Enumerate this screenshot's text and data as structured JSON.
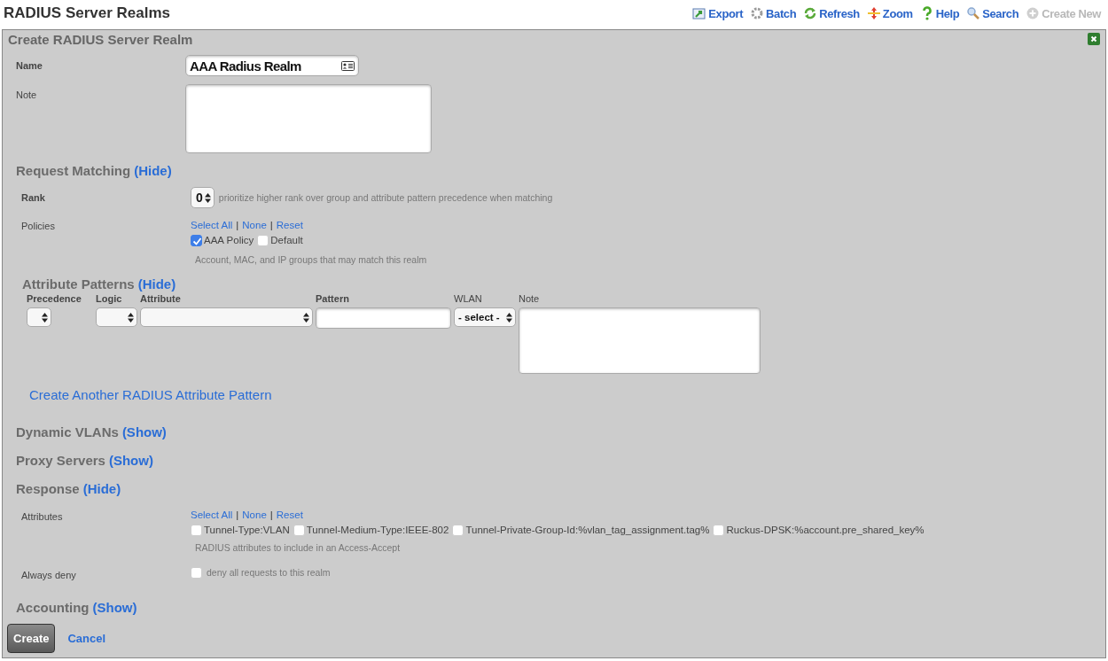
{
  "page_title": "RADIUS Server Realms",
  "toolbar": [
    {
      "kind": "export",
      "label": "Export",
      "disabled": false
    },
    {
      "kind": "batch",
      "label": "Batch",
      "disabled": false
    },
    {
      "kind": "refresh",
      "label": "Refresh",
      "disabled": false
    },
    {
      "kind": "zoom",
      "label": "Zoom",
      "disabled": false
    },
    {
      "kind": "help",
      "label": "Help",
      "disabled": false
    },
    {
      "kind": "search",
      "label": "Search",
      "disabled": false
    },
    {
      "kind": "create",
      "label": "Create New",
      "disabled": true
    }
  ],
  "panel": {
    "title": "Create RADIUS Server Realm"
  },
  "name": {
    "label": "Name",
    "value": "AAA Radius Realm",
    "required": true
  },
  "note": {
    "label": "Note",
    "required": false
  },
  "request_matching": {
    "title": "Request Matching",
    "toggle": "(Hide)",
    "rank": {
      "label": "Rank",
      "required": true,
      "value": "0",
      "hint": "prioritize higher rank over group and attribute pattern precedence when matching"
    },
    "policies": {
      "label": "Policies",
      "required": false,
      "links": {
        "items": [
          "Select All",
          "None",
          "Reset"
        ],
        "separator": "|"
      },
      "options": [
        {
          "label": "AAA Policy",
          "checked": true
        },
        {
          "label": "Default",
          "checked": false
        }
      ],
      "hint": "Account, MAC, and IP groups that may match this realm"
    }
  },
  "attribute_patterns": {
    "title": "Attribute Patterns",
    "toggle": "(Hide)",
    "columns": [
      {
        "label": "Precedence",
        "kind": "small-select",
        "required": true
      },
      {
        "label": "Logic",
        "kind": "select",
        "required": true
      },
      {
        "label": "Attribute",
        "kind": "wide-select",
        "required": true
      },
      {
        "label": "Pattern",
        "kind": "text",
        "required": true
      },
      {
        "label": "WLAN",
        "kind": "select",
        "required": false,
        "value": "- select -"
      },
      {
        "label": "Note",
        "kind": "textarea",
        "required": false
      }
    ],
    "link": "Create Another RADIUS Attribute Pattern"
  },
  "dynamic_vlans": {
    "title": "Dynamic VLANs",
    "toggle": "(Show)"
  },
  "proxy_servers": {
    "title": "Proxy Servers",
    "toggle": "(Show)"
  },
  "response": {
    "title": "Response",
    "toggle": "(Hide)",
    "attributes": {
      "label": "Attributes",
      "links": {
        "items": [
          "Select All",
          "None",
          "Reset"
        ],
        "separator": "|"
      },
      "options": [
        {
          "label": "Tunnel-Type:VLAN",
          "checked": false
        },
        {
          "label": "Tunnel-Medium-Type:IEEE-802",
          "checked": false
        },
        {
          "label": "Tunnel-Private-Group-Id:%vlan_tag_assignment.tag%",
          "checked": false
        },
        {
          "label": "Ruckus-DPSK:%account.pre_shared_key%",
          "checked": false
        }
      ],
      "hint": "RADIUS attributes to include in an Access-Accept"
    },
    "always_deny": {
      "label": "Always deny",
      "checked": false,
      "text": "deny all requests to this realm"
    }
  },
  "accounting": {
    "title": "Accounting",
    "toggle": "(Show)"
  },
  "buttons": {
    "create": "Create",
    "cancel": "Cancel"
  }
}
